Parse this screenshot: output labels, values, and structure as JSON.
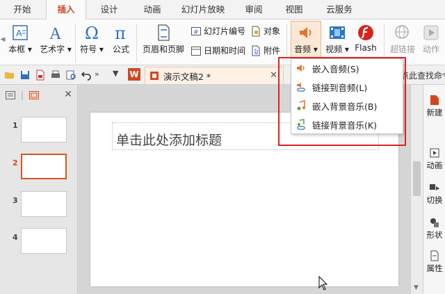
{
  "menu": {
    "tabs": [
      "开始",
      "插入",
      "设计",
      "动画",
      "幻灯片放映",
      "审阅",
      "视图",
      "云服务"
    ],
    "active": "插入"
  },
  "ribbon": {
    "textbox_label": "本框",
    "wordart_label": "艺术字",
    "symbol_label": "符号",
    "formula_label": "公式",
    "header_footer_label": "页眉和页脚",
    "slide_number_label": "幻灯片编号",
    "object_label": "对象",
    "datetime_label": "日期和时间",
    "attachment_label": "附件",
    "audio_label": "音频",
    "video_label": "视频",
    "flash_label": "Flash",
    "hyperlink_label": "超链接",
    "action_label": "动作"
  },
  "quickbar": {
    "doc_title": "演示文稿2 *",
    "search_hint": "点此查找命令"
  },
  "thumbnails": {
    "numbers": [
      "1",
      "2",
      "3",
      "4"
    ],
    "selected": "2"
  },
  "slide": {
    "title_placeholder": "单击此处添加标题"
  },
  "right_panel": {
    "items": [
      "新建",
      "动画",
      "切换",
      "形状",
      "属性"
    ]
  },
  "audio_menu": {
    "items": [
      "嵌入音频(S)",
      "链接到音频(L)",
      "嵌入背景音乐(B)",
      "链接背景音乐(K)"
    ]
  },
  "colors": {
    "accent": "#d2481e",
    "highlight": "#e02020",
    "audio_icon": "#e8742a",
    "flash": "#d9221c",
    "video": "#2b78c8",
    "blue_icon": "#2f6fc4"
  }
}
